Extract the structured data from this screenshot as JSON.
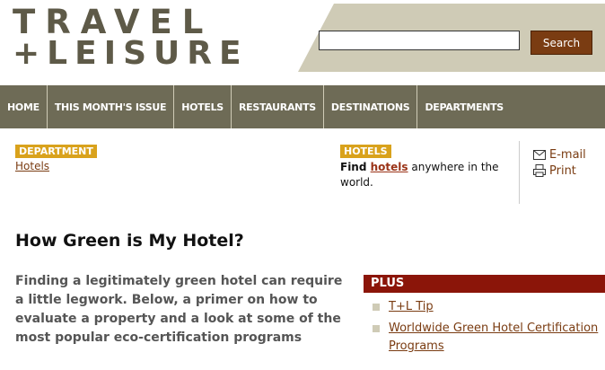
{
  "brand": {
    "line1": "TRAVEL",
    "line2": "+LEISURE",
    "color": "#5e5a48"
  },
  "search": {
    "value": "",
    "placeholder": "",
    "button_label": "Search"
  },
  "nav": {
    "items": [
      {
        "label": "HOME"
      },
      {
        "label": "THIS MONTH'S ISSUE"
      },
      {
        "label": "HOTELS"
      },
      {
        "label": "RESTAURANTS"
      },
      {
        "label": "DESTINATIONS"
      },
      {
        "label": "DEPARTMENTS"
      }
    ]
  },
  "department": {
    "label": "DEPARTMENT",
    "link": "Hotels"
  },
  "hotels_box": {
    "label": "HOTELS",
    "text_pre": "Find ",
    "link": "hotels",
    "text_post": " anywhere in the world."
  },
  "tools": {
    "email": "E-mail",
    "print": "Print"
  },
  "article": {
    "title": "How Green is My Hotel?",
    "intro": "Finding a legitimately green hotel can require a little legwork. Below, a primer on how to evaluate a property and a look at some of the most popular eco-certification programs"
  },
  "plus": {
    "header": "PLUS",
    "items": [
      {
        "label": "T+L Tip"
      },
      {
        "label": "Worldwide Green Hotel Certification Programs"
      }
    ]
  },
  "colors": {
    "nav_bg": "#6e6b56",
    "header_bg": "#cfcbb6",
    "accent_gold": "#d9a21c",
    "accent_red": "#8b1509",
    "link": "#7a3c12"
  }
}
